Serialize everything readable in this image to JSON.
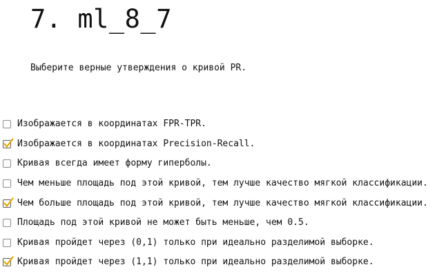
{
  "header": {
    "title": "7. ml_8_7"
  },
  "question": {
    "text": "Выберите верные утверждения о кривой PR."
  },
  "options": [
    {
      "label": "Изображается в координатах FPR-TPR.",
      "checked": false
    },
    {
      "label": "Изображается в координатах Precision-Recall.",
      "checked": true
    },
    {
      "label": "Кривая всегда имеет форму гиперболы.",
      "checked": false
    },
    {
      "label": "Чем меньше площадь под этой кривой, тем лучше качество мягкой классификации.",
      "checked": false
    },
    {
      "label": "Чем больше площадь под этой кривой, тем лучше качество мягкой классификации.",
      "checked": true
    },
    {
      "label": "Площадь под этой кривой не может быть меньше, чем 0.5.",
      "checked": false
    },
    {
      "label": "Кривая пройдет через (0,1) только при идеально разделимой выборке.",
      "checked": false
    },
    {
      "label": "Кривая пройдет через (1,1) только при идеально разделимой выборке.",
      "checked": true
    }
  ],
  "style": {
    "check_color": "#e0a800"
  }
}
